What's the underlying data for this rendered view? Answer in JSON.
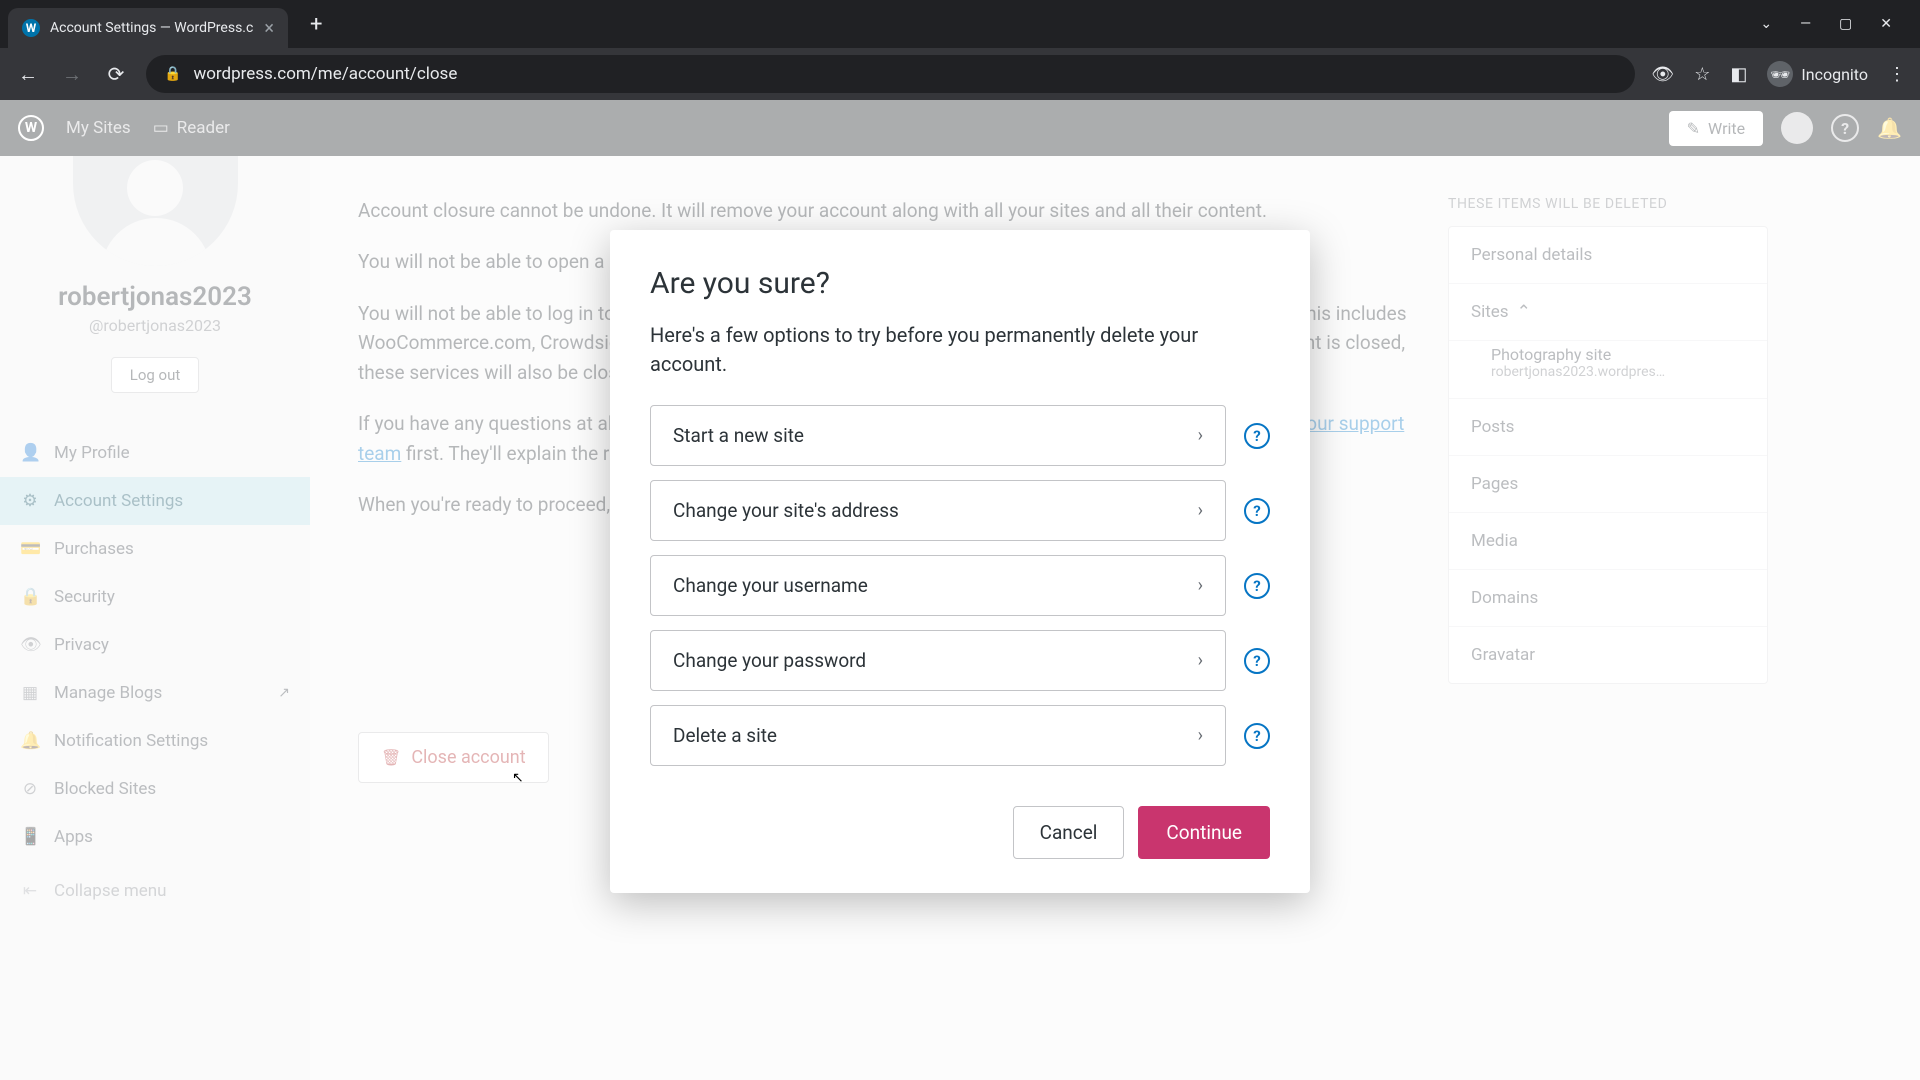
{
  "browser": {
    "tab_title": "Account Settings — WordPress.c",
    "url": "wordpress.com/me/account/close",
    "incognito_label": "Incognito"
  },
  "wpbar": {
    "my_sites": "My Sites",
    "reader": "Reader",
    "write": "Write"
  },
  "profile": {
    "display_name": "robertjonas2023",
    "handle": "@robertjonas2023",
    "logout": "Log out"
  },
  "sidebar": {
    "items": [
      {
        "label": "My Profile"
      },
      {
        "label": "Account Settings"
      },
      {
        "label": "Purchases"
      },
      {
        "label": "Security"
      },
      {
        "label": "Privacy"
      },
      {
        "label": "Manage Blogs"
      },
      {
        "label": "Notification Settings"
      },
      {
        "label": "Blocked Sites"
      },
      {
        "label": "Apps"
      }
    ],
    "collapse": "Collapse menu"
  },
  "content": {
    "p1": "Account closure cannot be undone. It will remove your account along with all your sites and all their content.",
    "p2": "You will not be able to open a new WordPress.com account using the same email address for 30 days.",
    "p3": "You will not be able to log in to any other Automattic Services that use your WordPress.com account as a login. This includes WooCommerce.com, Crowdsignal.com, IntenseDebate.com and Gravatar.com. Once your WordPress.com account is closed, these services will also be closed and you will lose access to any orders or support history you may have.",
    "p4a": "If you have any questions at all about what happens when you close an account, please ",
    "p4link": "chat with someone from our support team",
    "p4b": " first. They'll explain the ramifications and help you explore alternatives.",
    "p5": "When you're ready to proceed, use the \"Close account\" button.",
    "close_btn": "Close account"
  },
  "aside": {
    "title": "THESE ITEMS WILL BE DELETED",
    "personal": "Personal details",
    "sites_label": "Sites",
    "site_name": "Photography site",
    "site_url": "robertjonas2023.wordpres…",
    "posts": "Posts",
    "pages": "Pages",
    "media": "Media",
    "domains": "Domains",
    "gravatar": "Gravatar"
  },
  "modal": {
    "title": "Are you sure?",
    "subtitle": "Here's a few options to try before you permanently delete your account.",
    "options": [
      {
        "label": "Start a new site"
      },
      {
        "label": "Change your site's address"
      },
      {
        "label": "Change your username"
      },
      {
        "label": "Change your password"
      },
      {
        "label": "Delete a site"
      }
    ],
    "cancel": "Cancel",
    "continue": "Continue"
  }
}
